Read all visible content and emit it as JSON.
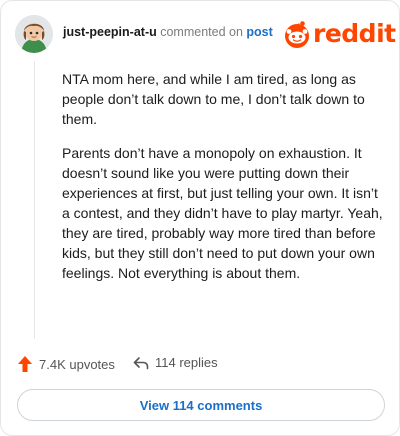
{
  "comment": {
    "username": "just-peepin-at-u",
    "action_text": "commented on",
    "post_link": "post",
    "paragraphs": [
      "NTA mom here, and while I am tired, as long as people don’t talk down to me, I don’t talk down to them.",
      "Parents don’t have a monopoly on exhaustion. It doesn’t sound like you were putting down their experiences at first, but just telling your own. It isn’t a contest, and they didn’t have to play martyr. Yeah, they are tired, probably way more tired than before kids, but they still don’t need to put down your own feelings. Not everything is about them."
    ]
  },
  "brand": {
    "name": "reddit",
    "color": "#ff4500"
  },
  "icons": {
    "upvote": "upvote-arrow-icon",
    "reply": "reply-arrow-icon",
    "logo": "reddit-snoo-icon"
  },
  "actions": {
    "upvotes_label": "7.4K upvotes",
    "replies_label": "114 replies"
  },
  "footer": {
    "view_button_label": "View 114 comments"
  }
}
